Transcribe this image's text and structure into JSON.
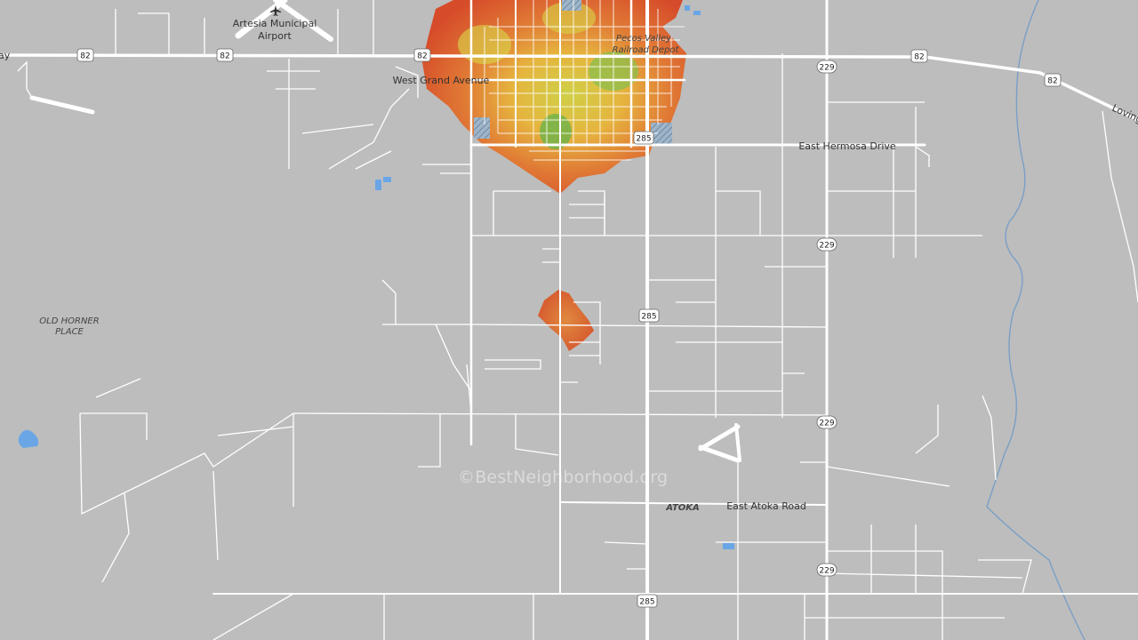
{
  "map": {
    "watermark": "©BestNeighborhood.org",
    "places": {
      "airport": "Artesia Municipal\nAirport",
      "airport_line1": "Artesia Municipal",
      "airport_line2": "Airport",
      "railroad_line1": "Pecos Valley",
      "railroad_line2": "Railroad Depot",
      "horner_line1": "OLD HORNER",
      "horner_line2": "PLACE",
      "atoka": "ATOKA"
    },
    "roads": {
      "west_grand": "West Grand Avenue",
      "hermosa": "East Hermosa Drive",
      "atoka_road": "East Atoka Road",
      "loving": "Loving",
      "left_edge": "ay"
    },
    "shields": {
      "us82": "82",
      "us285": "285",
      "nm229": "229"
    },
    "colors": {
      "background": "#bdbdbd",
      "road": "#ffffff",
      "water": "#6aa6e6",
      "heat_low": "#d9502a",
      "heat_mid": "#e8a33a",
      "heat_high": "#d8d640",
      "heat_top": "#7cb84a"
    },
    "icons": [
      "airport-icon"
    ]
  }
}
